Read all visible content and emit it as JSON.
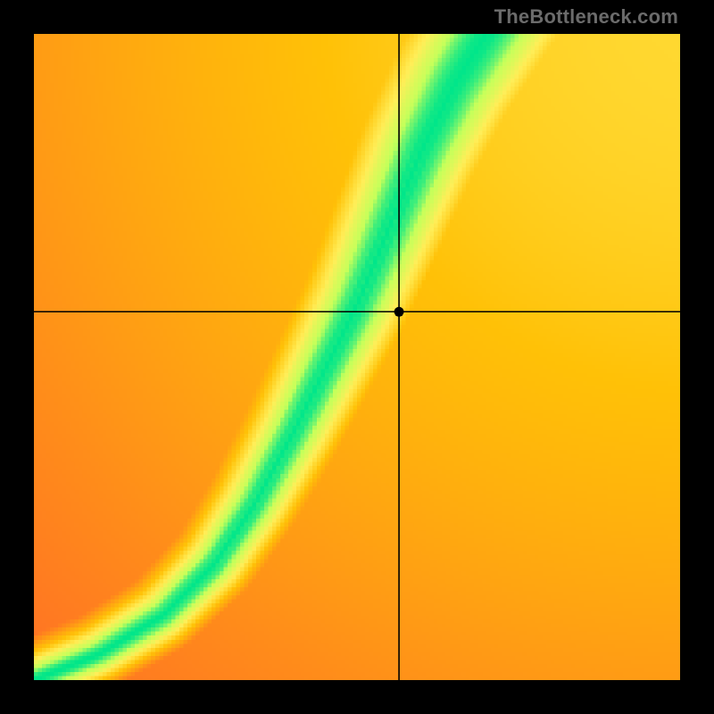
{
  "watermark": "TheBottleneck.com",
  "chart_data": {
    "type": "heatmap",
    "title": "",
    "xlabel": "",
    "ylabel": "",
    "xlim": [
      0,
      1
    ],
    "ylim": [
      0,
      1
    ],
    "grid": false,
    "legend": false,
    "crosshair": {
      "x": 0.565,
      "y": 0.57
    },
    "marker": {
      "x": 0.565,
      "y": 0.57
    },
    "ridge_control_points": [
      {
        "x": 0.0,
        "y": 0.0
      },
      {
        "x": 0.1,
        "y": 0.04
      },
      {
        "x": 0.2,
        "y": 0.1
      },
      {
        "x": 0.28,
        "y": 0.18
      },
      {
        "x": 0.34,
        "y": 0.27
      },
      {
        "x": 0.4,
        "y": 0.38
      },
      {
        "x": 0.45,
        "y": 0.48
      },
      {
        "x": 0.5,
        "y": 0.58
      },
      {
        "x": 0.55,
        "y": 0.7
      },
      {
        "x": 0.6,
        "y": 0.82
      },
      {
        "x": 0.65,
        "y": 0.92
      },
      {
        "x": 0.7,
        "y": 1.0
      }
    ],
    "colormap": [
      {
        "t": 0.0,
        "color": "#ff1744"
      },
      {
        "t": 0.35,
        "color": "#ff5330"
      },
      {
        "t": 0.55,
        "color": "#ff8c1a"
      },
      {
        "t": 0.72,
        "color": "#ffc107"
      },
      {
        "t": 0.85,
        "color": "#ffee58"
      },
      {
        "t": 0.94,
        "color": "#c6ff5a"
      },
      {
        "t": 1.0,
        "color": "#00e68a"
      }
    ],
    "resolution": 160,
    "ridge_sigma_base": 0.03,
    "ridge_sigma_growth": 0.055,
    "far_field_falloff": 2.5,
    "top_right_bias": {
      "cx": 1.05,
      "cy": 1.05,
      "strength": 0.55,
      "spread": 0.9
    },
    "left_bias": {
      "cx": -0.05,
      "cy": 0.75,
      "strength": 0.25,
      "spread": 0.65
    }
  }
}
